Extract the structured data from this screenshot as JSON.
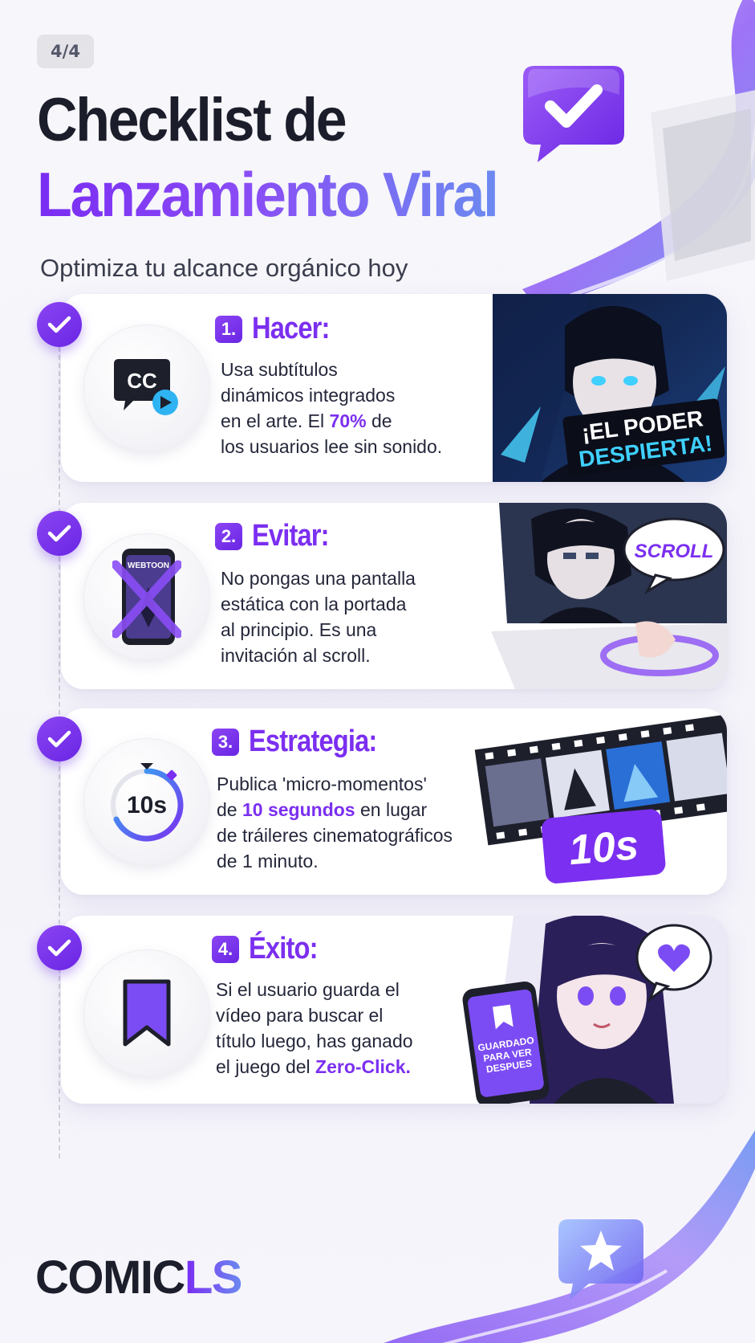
{
  "page_indicator": "4/4",
  "title": {
    "line1": "Checklist de",
    "line2": "Lanzamiento Viral"
  },
  "subtitle": "Optimiza tu alcance orgánico hoy",
  "steps": [
    {
      "number": "1.",
      "title": "Hacer:",
      "body": [
        {
          "parts": [
            {
              "text": "Usa subtítulos"
            }
          ]
        },
        {
          "parts": [
            {
              "text": "dinámicos integrados"
            }
          ]
        },
        {
          "parts": [
            {
              "text": "en el arte. El "
            },
            {
              "text": "70%",
              "highlight": true
            },
            {
              "text": " de"
            }
          ]
        },
        {
          "parts": [
            {
              "text": "los usuarios lee sin sonido."
            }
          ]
        }
      ],
      "icon": "closed-captions-icon",
      "icon_text": "CC",
      "art_caption_line1": "¡EL PODER",
      "art_caption_line2": "DESPIERTA!"
    },
    {
      "number": "2.",
      "title": "Evitar:",
      "body": [
        {
          "parts": [
            {
              "text": "No pongas una pantalla"
            }
          ]
        },
        {
          "parts": [
            {
              "text": "estática con la portada"
            }
          ]
        },
        {
          "parts": [
            {
              "text": "al principio. Es una"
            }
          ]
        },
        {
          "parts": [
            {
              "text": "invitación al scroll."
            }
          ]
        }
      ],
      "icon": "phone-crossed-icon",
      "icon_text": "WEBTOON",
      "art_caption": "SCROLL"
    },
    {
      "number": "3.",
      "title": "Estrategia:",
      "body": [
        {
          "parts": [
            {
              "text": "Publica 'micro-momentos'"
            }
          ]
        },
        {
          "parts": [
            {
              "text": "de "
            },
            {
              "text": "10 segundos",
              "highlight": true
            },
            {
              "text": " en lugar"
            }
          ]
        },
        {
          "parts": [
            {
              "text": "de tráileres cinematográficos"
            }
          ]
        },
        {
          "parts": [
            {
              "text": "de 1 minuto."
            }
          ]
        }
      ],
      "icon": "timer-icon",
      "icon_text": "10s",
      "art_caption": "10s"
    },
    {
      "number": "4.",
      "title": "Éxito:",
      "body": [
        {
          "parts": [
            {
              "text": "Si el usuario guarda el"
            }
          ]
        },
        {
          "parts": [
            {
              "text": "vídeo para buscar el"
            }
          ]
        },
        {
          "parts": [
            {
              "text": "título luego, has ganado"
            }
          ]
        },
        {
          "parts": [
            {
              "text": "el juego del "
            },
            {
              "text": "Zero-Click.",
              "highlight": true
            }
          ]
        }
      ],
      "icon": "bookmark-icon",
      "art_caption_lines": [
        "GUARDADO",
        "PARA VER",
        "DESPUES"
      ]
    }
  ],
  "logo": {
    "part1": "COMIC",
    "part2": "LS"
  },
  "colors": {
    "accent": "#7b2ff0",
    "accent_dark": "#6a25e4",
    "text": "#1f2230",
    "blue": "#6c8af0"
  }
}
